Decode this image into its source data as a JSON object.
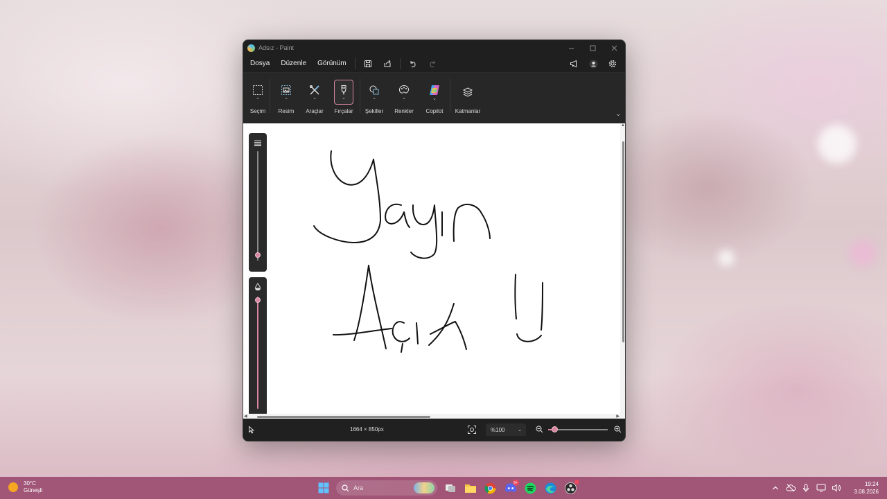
{
  "window": {
    "title": "Adsız - Paint"
  },
  "menu": {
    "file": "Dosya",
    "edit": "Düzenle",
    "view": "Görünüm"
  },
  "ribbon": {
    "groups": [
      {
        "label": "Seçim",
        "icon": "selection-icon"
      },
      {
        "label": "Resim",
        "icon": "image-icon"
      },
      {
        "label": "Araçlar",
        "icon": "tools-icon"
      },
      {
        "label": "Fırçalar",
        "icon": "brush-icon"
      },
      {
        "label": "Şekiller",
        "icon": "shapes-icon"
      },
      {
        "label": "Renkler",
        "icon": "palette-icon"
      },
      {
        "label": "Copilot",
        "icon": "copilot-icon"
      },
      {
        "label": "Katmanlar",
        "icon": "layers-icon"
      }
    ],
    "active_tool": "Fırçalar"
  },
  "canvas": {
    "handwritten_text": [
      "Yayın",
      "Açık !!"
    ],
    "size_slider_level": 0.05,
    "opacity_slider_level": 0.97
  },
  "statusbar": {
    "dimensions": "1664 × 850px",
    "zoom": "%100",
    "zoom_slider_level": 0.12
  },
  "taskbar": {
    "weather_temp": "30°C",
    "weather_desc": "Güneşli",
    "search_placeholder": "Ara",
    "discord_badge": "9+",
    "time": "19:24",
    "date": "3.08.2026"
  },
  "colors": {
    "accent": "#d8869f",
    "window_bg": "#1f1f1f",
    "ribbon_bg": "#272727",
    "taskbar_bg": "#98486c"
  }
}
